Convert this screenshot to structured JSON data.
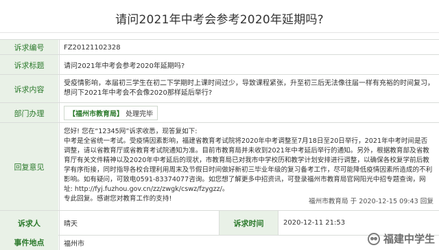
{
  "page": {
    "title": "请问2021年中考会参考2020年延期吗?"
  },
  "fields": {
    "number_label": "诉求编号",
    "number_value": "FZ20121102328",
    "subject_label": "诉求标题",
    "subject_value": "请问2021年中考会参考2020年延期吗?",
    "content_label": "诉求内容",
    "content_value": "受疫情影响，本届初三学生在初二下学期时上课时间过少，导致课程紧张，升至初三后无法像往届一样有充裕的时间复习，想问下2021年中考会不会像2020那样延后举行?",
    "dept_label": "部门办理",
    "dept_name": "【福州市教育局】",
    "dept_status": "处理完毕",
    "reply_label": "回复意见",
    "reply_line1": "您好! 您在“12345网”诉求收悉，现答复如下:",
    "reply_body": "中考是全省统一考试。受疫情因素影响，福建省教育考试院将2020年中考调整至7月18日至20日举行，2021年中考时间是否调整，请以省教育厅或省教育考试院通知为准。目前市教育局并未收到2021年中考延后举行的通知。另外，根据教育部及省教育厅有关文件精神以及2020年中考延后的现状，市教育局已对我市中学校历和教学计划安排进行调整，以确保各校复学前后教学有序衔接，同时指导各校合理利用周末及节假日时间做好新初三毕业年级的复习备考工作，尽可能降低疫情因素所造成的不利影响。如有疑问，可致电0591-83374077咨询。如您想了解更多中招资讯，可登录福州市教育局官网阳光中招专题查询，网址: http://fyj.fuzhou.gov.cn/zz/zwgk/cswz/fzygzz/。",
    "reply_line_end": "专此回复。感谢您对教育工作的支持!",
    "reply_footer": "福州市教育局 于 2020-12-15 09:43 回复",
    "requester_label": "诉求人",
    "requester_value": "晴天",
    "time_label": "诉求时间",
    "time_value": "2020-12-11 21:53",
    "location_label": "事件地点",
    "location_value": "福州市"
  },
  "watermark": {
    "text": "福建中学生"
  }
}
